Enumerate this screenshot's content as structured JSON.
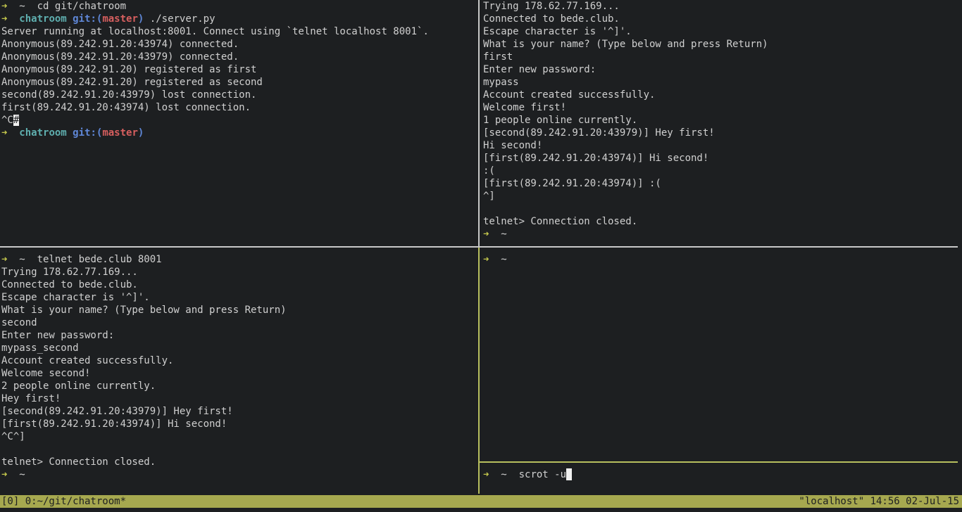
{
  "panes": {
    "top_left": {
      "lines": [
        {
          "type": "prompt_cmd",
          "dir": "~",
          "command": "cd git/chatroom"
        },
        {
          "type": "prompt_git",
          "dir": "chatroom",
          "git_label": "git:",
          "branch": "master",
          "command": "./server.py"
        },
        {
          "type": "text",
          "text": "Server running at localhost:8001. Connect using `telnet localhost 8001`."
        },
        {
          "type": "text",
          "text": "Anonymous(89.242.91.20:43974) connected."
        },
        {
          "type": "text",
          "text": "Anonymous(89.242.91.20:43979) connected."
        },
        {
          "type": "text",
          "text": "Anonymous(89.242.91.20) registered as first"
        },
        {
          "type": "text",
          "text": "Anonymous(89.242.91.20) registered as second"
        },
        {
          "type": "text",
          "text": "second(89.242.91.20:43979) lost connection."
        },
        {
          "type": "text",
          "text": "first(89.242.91.20:43974) lost connection."
        },
        {
          "type": "text_cursor",
          "text": "^C",
          "cursor_char": "#"
        },
        {
          "type": "prompt_git",
          "dir": "chatroom",
          "git_label": "git:",
          "branch": "master",
          "command": ""
        }
      ]
    },
    "top_right": {
      "lines": [
        {
          "type": "text",
          "text": "Trying 178.62.77.169..."
        },
        {
          "type": "text",
          "text": "Connected to bede.club."
        },
        {
          "type": "text",
          "text": "Escape character is '^]'."
        },
        {
          "type": "text",
          "text": "What is your name? (Type below and press Return)"
        },
        {
          "type": "text",
          "text": "first"
        },
        {
          "type": "text",
          "text": "Enter new password:"
        },
        {
          "type": "text",
          "text": "mypass"
        },
        {
          "type": "text",
          "text": "Account created successfully."
        },
        {
          "type": "text",
          "text": "Welcome first!"
        },
        {
          "type": "text",
          "text": "1 people online currently."
        },
        {
          "type": "text",
          "text": "[second(89.242.91.20:43979)] Hey first!"
        },
        {
          "type": "text",
          "text": "Hi second!"
        },
        {
          "type": "text",
          "text": "[first(89.242.91.20:43974)] Hi second!"
        },
        {
          "type": "text",
          "text": ":("
        },
        {
          "type": "text",
          "text": "[first(89.242.91.20:43974)] :("
        },
        {
          "type": "text",
          "text": "^]"
        },
        {
          "type": "text",
          "text": ""
        },
        {
          "type": "text",
          "text": "telnet> Connection closed."
        },
        {
          "type": "prompt_cmd",
          "dir": "~",
          "command": ""
        }
      ]
    },
    "bottom_left": {
      "lines": [
        {
          "type": "prompt_cmd",
          "dir": "~",
          "command": "telnet bede.club 8001"
        },
        {
          "type": "text",
          "text": "Trying 178.62.77.169..."
        },
        {
          "type": "text",
          "text": "Connected to bede.club."
        },
        {
          "type": "text",
          "text": "Escape character is '^]'."
        },
        {
          "type": "text",
          "text": "What is your name? (Type below and press Return)"
        },
        {
          "type": "text",
          "text": "second"
        },
        {
          "type": "text",
          "text": "Enter new password:"
        },
        {
          "type": "text",
          "text": "mypass_second"
        },
        {
          "type": "text",
          "text": "Account created successfully."
        },
        {
          "type": "text",
          "text": "Welcome second!"
        },
        {
          "type": "text",
          "text": "2 people online currently."
        },
        {
          "type": "text",
          "text": "Hey first!"
        },
        {
          "type": "text",
          "text": "[second(89.242.91.20:43979)] Hey first!"
        },
        {
          "type": "text",
          "text": "[first(89.242.91.20:43974)] Hi second!"
        },
        {
          "type": "text",
          "text": "^C^]"
        },
        {
          "type": "text",
          "text": ""
        },
        {
          "type": "text",
          "text": "telnet> Connection closed."
        },
        {
          "type": "prompt_cmd",
          "dir": "~",
          "command": ""
        }
      ]
    },
    "bottom_right_upper": {
      "lines": [
        {
          "type": "prompt_cmd",
          "dir": "~",
          "command": ""
        }
      ]
    },
    "bottom_right_lower": {
      "lines": [
        {
          "type": "prompt_cursor",
          "dir": "~",
          "command": "scrot -u"
        }
      ]
    }
  },
  "symbols": {
    "prompt_arrow": "➜"
  },
  "statusbar": {
    "left": "[0] 0:~/git/chatroom*",
    "right": "\"localhost\" 14:56 02-Jul-15"
  },
  "colors": {
    "background": "#1d1f21",
    "text": "#d0d0d0",
    "prompt_arrow": "#c5c84d",
    "dir": "#5fafaf",
    "git_label": "#5f87d7",
    "branch": "#d75f5f",
    "statusbar_bg": "#a6a84f",
    "active_border": "#b7bf5e"
  }
}
